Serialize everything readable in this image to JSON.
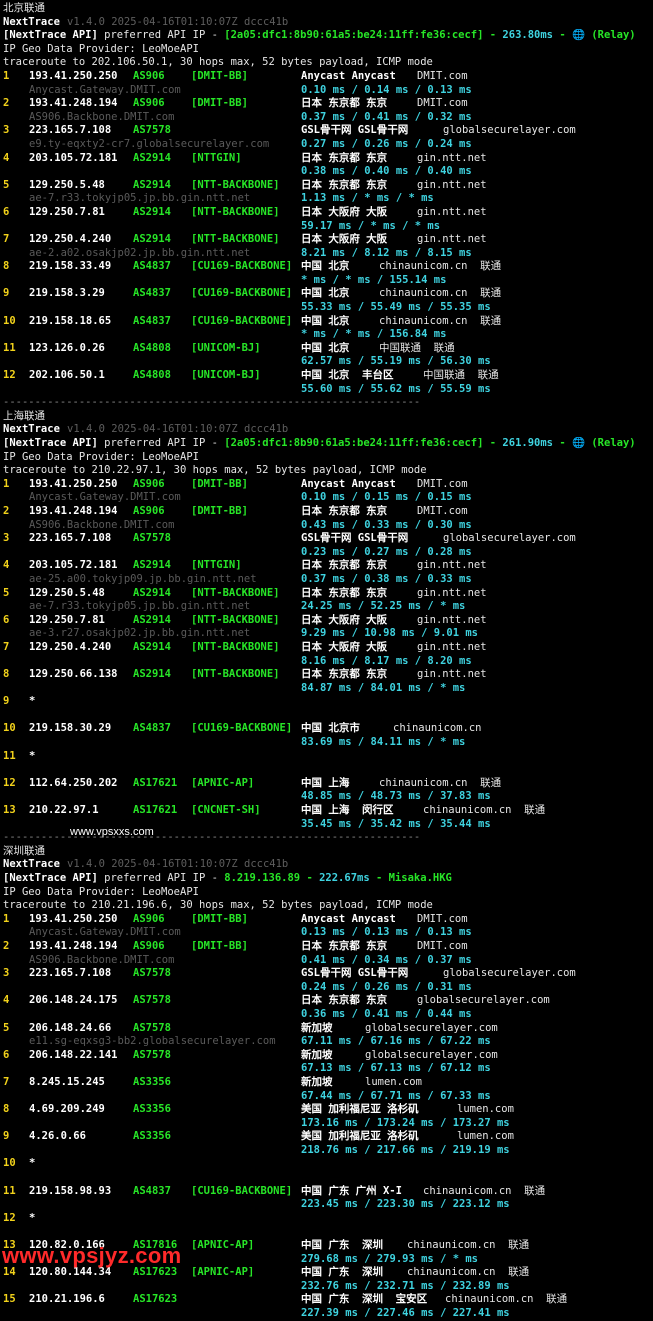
{
  "sections": [
    {
      "title": "北京联通",
      "version_line": {
        "name": "NextTrace",
        "meta": "v1.4.0 2025-04-16T01:10:07Z dccc41b"
      },
      "api_line": {
        "prefix": "[NextTrace API]",
        "text": " preferred API IP - ",
        "ip": "[2a05:dfc1:8b90:61a5:be24:11ff:fe36:cecf]",
        "dash": " - ",
        "latency": "263.80ms",
        "tail": " - 🌐 (Relay)"
      },
      "provider": "IP Geo Data Provider: LeoMoeAPI",
      "traceroute": "traceroute to 202.106.50.1, 30 hops max, 52 bytes payload, ICMP mode",
      "hops": [
        {
          "n": "1",
          "ip": "193.41.250.250",
          "as": "AS906",
          "tag": "[DMIT-BB]",
          "geo": "Anycast Anycast",
          "dom": "DMIT.com",
          "host": "Anycast.Gateway.DMIT.com",
          "rtt": "0.10 ms / 0.14 ms / 0.13 ms"
        },
        {
          "n": "2",
          "ip": "193.41.248.194",
          "as": "AS906",
          "tag": "[DMIT-BB]",
          "geo": "日本 东京都 东京",
          "dom": "DMIT.com",
          "host": "AS906.Backbone.DMIT.com",
          "rtt": "0.37 ms / 0.41 ms / 0.32 ms"
        },
        {
          "n": "3",
          "ip": "223.165.7.108",
          "as": "AS7578",
          "tag": "",
          "geo": "GSL骨干网 GSL骨干网",
          "dom": "globalsecurelayer.com",
          "host": "e9.ty-eqxty2-cr7.globalsecurelayer.com",
          "rtt": "0.27 ms / 0.26 ms / 0.24 ms"
        },
        {
          "n": "4",
          "ip": "203.105.72.181",
          "as": "AS2914",
          "tag": "[NTTGIN]",
          "geo": "日本 东京都 东京",
          "dom": "gin.ntt.net",
          "host": "",
          "rtt": "0.38 ms / 0.40 ms / 0.40 ms"
        },
        {
          "n": "5",
          "ip": "129.250.5.48",
          "as": "AS2914",
          "tag": "[NTT-BACKBONE]",
          "geo": "日本 东京都 东京",
          "dom": "gin.ntt.net",
          "host": "ae-7.r33.tokyjp05.jp.bb.gin.ntt.net",
          "rtt": "1.13 ms / * ms / * ms"
        },
        {
          "n": "6",
          "ip": "129.250.7.81",
          "as": "AS2914",
          "tag": "[NTT-BACKBONE]",
          "geo": "日本 大阪府 大阪",
          "dom": "gin.ntt.net",
          "host": "",
          "rtt": "59.17 ms / * ms / * ms"
        },
        {
          "n": "7",
          "ip": "129.250.4.240",
          "as": "AS2914",
          "tag": "[NTT-BACKBONE]",
          "geo": "日本 大阪府 大阪",
          "dom": "gin.ntt.net",
          "host": "ae-2.a02.osakjp02.jp.bb.gin.ntt.net",
          "rtt": "8.21 ms / 8.12 ms / 8.15 ms"
        },
        {
          "n": "8",
          "ip": "219.158.33.49",
          "as": "AS4837",
          "tag": "[CU169-BACKBONE]",
          "geo": "中国 北京",
          "dom": "chinaunicom.cn  联通",
          "host": "",
          "rtt": "* ms / * ms / 155.14 ms"
        },
        {
          "n": "9",
          "ip": "219.158.3.29",
          "as": "AS4837",
          "tag": "[CU169-BACKBONE]",
          "geo": "中国 北京",
          "dom": "chinaunicom.cn  联通",
          "host": "",
          "rtt": "55.33 ms / 55.49 ms / 55.35 ms"
        },
        {
          "n": "10",
          "ip": "219.158.18.65",
          "as": "AS4837",
          "tag": "[CU169-BACKBONE]",
          "geo": "中国 北京",
          "dom": "chinaunicom.cn  联通",
          "host": "",
          "rtt": "* ms / * ms / 156.84 ms"
        },
        {
          "n": "11",
          "ip": "123.126.0.26",
          "as": "AS4808",
          "tag": "[UNICOM-BJ]",
          "geo": "中国 北京",
          "dom": "中国联通  联通",
          "host": "",
          "rtt": "62.57 ms / 55.19 ms / 56.30 ms"
        },
        {
          "n": "12",
          "ip": "202.106.50.1",
          "as": "AS4808",
          "tag": "[UNICOM-BJ]",
          "geo": "中国 北京  丰台区",
          "dom": "中国联通  联通",
          "host": "",
          "rtt": "55.60 ms / 55.62 ms / 55.59 ms"
        }
      ],
      "separator": "------------------------------------------------------------------"
    },
    {
      "title": "上海联通",
      "version_line": {
        "name": "NextTrace",
        "meta": "v1.4.0 2025-04-16T01:10:07Z dccc41b"
      },
      "api_line": {
        "prefix": "[NextTrace API]",
        "text": " preferred API IP - ",
        "ip": "[2a05:dfc1:8b90:61a5:be24:11ff:fe36:cecf]",
        "dash": " - ",
        "latency": "261.90ms",
        "tail": " - 🌐 (Relay)"
      },
      "provider": "IP Geo Data Provider: LeoMoeAPI",
      "traceroute": "traceroute to 210.22.97.1, 30 hops max, 52 bytes payload, ICMP mode",
      "hops": [
        {
          "n": "1",
          "ip": "193.41.250.250",
          "as": "AS906",
          "tag": "[DMIT-BB]",
          "geo": "Anycast Anycast",
          "dom": "DMIT.com",
          "host": "Anycast.Gateway.DMIT.com",
          "rtt": "0.10 ms / 0.15 ms / 0.15 ms"
        },
        {
          "n": "2",
          "ip": "193.41.248.194",
          "as": "AS906",
          "tag": "[DMIT-BB]",
          "geo": "日本 东京都 东京",
          "dom": "DMIT.com",
          "host": "AS906.Backbone.DMIT.com",
          "rtt": "0.43 ms / 0.33 ms / 0.30 ms"
        },
        {
          "n": "3",
          "ip": "223.165.7.108",
          "as": "AS7578",
          "tag": "",
          "geo": "GSL骨干网 GSL骨干网",
          "dom": "globalsecurelayer.com",
          "host": "",
          "rtt": "0.23 ms / 0.27 ms / 0.28 ms"
        },
        {
          "n": "4",
          "ip": "203.105.72.181",
          "as": "AS2914",
          "tag": "[NTTGIN]",
          "geo": "日本 东京都 东京",
          "dom": "gin.ntt.net",
          "host": "ae-25.a00.tokyjp09.jp.bb.gin.ntt.net",
          "rtt": "0.37 ms / 0.38 ms / 0.33 ms"
        },
        {
          "n": "5",
          "ip": "129.250.5.48",
          "as": "AS2914",
          "tag": "[NTT-BACKBONE]",
          "geo": "日本 东京都 东京",
          "dom": "gin.ntt.net",
          "host": "ae-7.r33.tokyjp05.jp.bb.gin.ntt.net",
          "rtt": "24.25 ms / 52.25 ms / * ms"
        },
        {
          "n": "6",
          "ip": "129.250.7.81",
          "as": "AS2914",
          "tag": "[NTT-BACKBONE]",
          "geo": "日本 大阪府 大阪",
          "dom": "gin.ntt.net",
          "host": "ae-3.r27.osakjp02.jp.bb.gin.ntt.net",
          "rtt": "9.29 ms / 10.98 ms / 9.01 ms"
        },
        {
          "n": "7",
          "ip": "129.250.4.240",
          "as": "AS2914",
          "tag": "[NTT-BACKBONE]",
          "geo": "日本 大阪府 大阪",
          "dom": "gin.ntt.net",
          "host": "",
          "rtt": "8.16 ms / 8.17 ms / 8.20 ms"
        },
        {
          "n": "8",
          "ip": "129.250.66.138",
          "as": "AS2914",
          "tag": "[NTT-BACKBONE]",
          "geo": "日本 东京都 东京",
          "dom": "gin.ntt.net",
          "host": "",
          "rtt": "84.87 ms / 84.01 ms / * ms"
        },
        {
          "n": "9",
          "star": true
        },
        {
          "n": "10",
          "ip": "219.158.30.29",
          "as": "AS4837",
          "tag": "[CU169-BACKBONE]",
          "geo": "中国 北京市",
          "dom": "chinaunicom.cn",
          "host": "",
          "rtt": "83.69 ms / 84.11 ms / * ms"
        },
        {
          "n": "11",
          "star": true
        },
        {
          "n": "12",
          "ip": "112.64.250.202",
          "as": "AS17621",
          "tag": "[APNIC-AP]",
          "geo": "中国 上海",
          "dom": "chinaunicom.cn  联通",
          "host": "",
          "rtt": "48.85 ms / 48.73 ms / 37.83 ms"
        },
        {
          "n": "13",
          "ip": "210.22.97.1",
          "as": "AS17621",
          "tag": "[CNCNET-SH]",
          "geo": "中国 上海  闵行区",
          "dom": "chinaunicom.cn  联通",
          "host": "",
          "rtt": "35.45 ms / 35.42 ms / 35.44 ms"
        }
      ],
      "separator": "------------------------------------------------------------------"
    },
    {
      "title": "深圳联通",
      "version_line": {
        "name": "NextTrace",
        "meta": "v1.4.0 2025-04-16T01:10:07Z dccc41b"
      },
      "api_line": {
        "prefix": "[NextTrace API]",
        "text": " preferred API IP - ",
        "ip": "8.219.136.89",
        "dash": " - ",
        "latency": "222.67ms",
        "tail": " - Misaka.HKG"
      },
      "provider": "IP Geo Data Provider: LeoMoeAPI",
      "traceroute": "traceroute to 210.21.196.6, 30 hops max, 52 bytes payload, ICMP mode",
      "hops": [
        {
          "n": "1",
          "ip": "193.41.250.250",
          "as": "AS906",
          "tag": "[DMIT-BB]",
          "geo": "Anycast Anycast",
          "dom": "DMIT.com",
          "host": "Anycast.Gateway.DMIT.com",
          "rtt": "0.13 ms / 0.13 ms / 0.13 ms"
        },
        {
          "n": "2",
          "ip": "193.41.248.194",
          "as": "AS906",
          "tag": "[DMIT-BB]",
          "geo": "日本 东京都 东京",
          "dom": "DMIT.com",
          "host": "AS906.Backbone.DMIT.com",
          "rtt": "0.41 ms / 0.34 ms / 0.37 ms"
        },
        {
          "n": "3",
          "ip": "223.165.7.108",
          "as": "AS7578",
          "tag": "",
          "geo": "GSL骨干网 GSL骨干网",
          "dom": "globalsecurelayer.com",
          "host": "",
          "rtt": "0.24 ms / 0.26 ms / 0.31 ms"
        },
        {
          "n": "4",
          "ip": "206.148.24.175",
          "as": "AS7578",
          "tag": "",
          "geo": "日本 东京都 东京",
          "dom": "globalsecurelayer.com",
          "host": "",
          "rtt": "0.36 ms / 0.41 ms / 0.44 ms"
        },
        {
          "n": "5",
          "ip": "206.148.24.66",
          "as": "AS7578",
          "tag": "",
          "geo": "新加坡",
          "dom": "globalsecurelayer.com",
          "host": "e11.sg-eqxsg3-bb2.globalsecurelayer.com",
          "rtt": "67.11 ms / 67.16 ms / 67.22 ms"
        },
        {
          "n": "6",
          "ip": "206.148.22.141",
          "as": "AS7578",
          "tag": "",
          "geo": "新加坡",
          "dom": "globalsecurelayer.com",
          "host": "",
          "rtt": "67.13 ms / 67.13 ms / 67.12 ms"
        },
        {
          "n": "7",
          "ip": "8.245.15.245",
          "as": "AS3356",
          "tag": "",
          "geo": "新加坡",
          "dom": "lumen.com",
          "host": "",
          "rtt": "67.44 ms / 67.71 ms / 67.33 ms"
        },
        {
          "n": "8",
          "ip": "4.69.209.249",
          "as": "AS3356",
          "tag": "",
          "geo": "美国 加利福尼亚 洛杉矶",
          "dom": "lumen.com",
          "host": "",
          "rtt": "173.16 ms / 173.24 ms / 173.27 ms"
        },
        {
          "n": "9",
          "ip": "4.26.0.66",
          "as": "AS3356",
          "tag": "",
          "geo": "美国 加利福尼亚 洛杉矶",
          "dom": "lumen.com",
          "host": "",
          "rtt": "218.76 ms / 217.66 ms / 219.19 ms"
        },
        {
          "n": "10",
          "star": true
        },
        {
          "n": "11",
          "ip": "219.158.98.93",
          "as": "AS4837",
          "tag": "[CU169-BACKBONE]",
          "geo": "中国 广东 广州 X-I",
          "dom": "chinaunicom.cn  联通",
          "host": "",
          "rtt": "223.45 ms / 223.30 ms / 223.12 ms"
        },
        {
          "n": "12",
          "star": true
        },
        {
          "n": "13",
          "ip": "120.82.0.166",
          "as": "AS17816",
          "tag": "[APNIC-AP]",
          "geo": "中国 广东  深圳",
          "dom": "chinaunicom.cn  联通",
          "host": "",
          "rtt": "279.68 ms / 279.93 ms / * ms"
        },
        {
          "n": "14",
          "ip": "120.80.144.34",
          "as": "AS17623",
          "tag": "[APNIC-AP]",
          "geo": "中国 广东  深圳",
          "dom": "chinaunicom.cn  联通",
          "host": "",
          "rtt": "232.76 ms / 232.71 ms / 232.89 ms"
        },
        {
          "n": "15",
          "ip": "210.21.196.6",
          "as": "AS17623",
          "tag": "",
          "geo": "中国 广东  深圳  宝安区",
          "dom": "chinaunicom.cn  联通",
          "host": "",
          "rtt": "227.39 ms / 227.46 ms / 227.41 ms"
        }
      ]
    }
  ],
  "watermark_small": "www.vpsxxs.com",
  "watermark_large": "www.vpsjyz.com",
  "colors": {
    "background": "#000000",
    "hop": "#f2d21b",
    "as": "#27e627",
    "rtt": "#3fd3e0",
    "dim": "#5e5e5e"
  }
}
